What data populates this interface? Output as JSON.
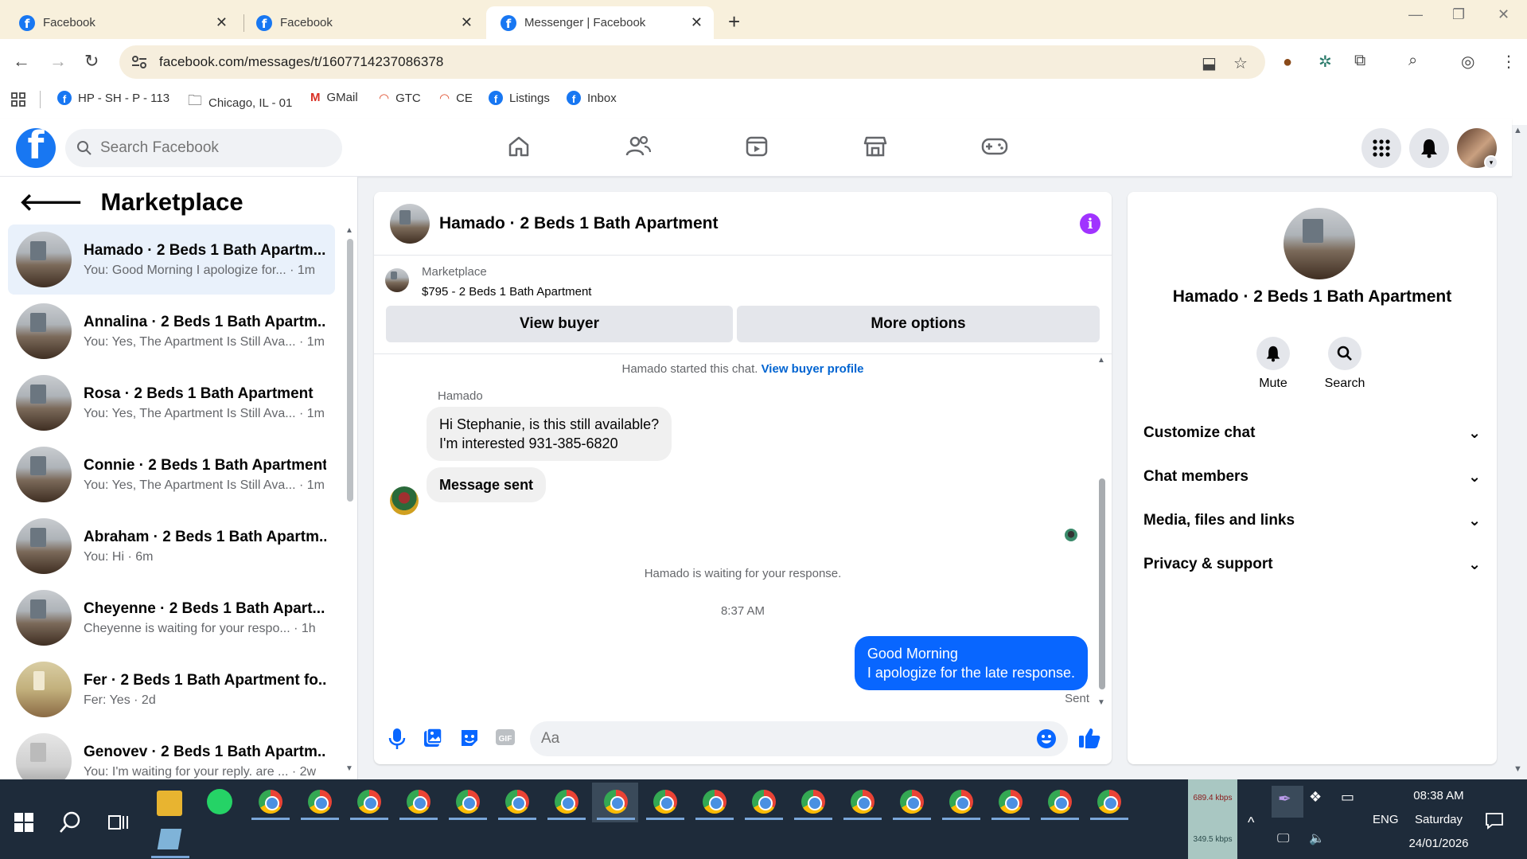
{
  "browser": {
    "tabs": [
      {
        "title": "Facebook",
        "active": false
      },
      {
        "title": "Facebook",
        "active": false
      },
      {
        "title": "Messenger | Facebook",
        "active": true
      }
    ],
    "url": "facebook.com/messages/t/1607714237086378",
    "bookmarks": [
      {
        "label": "HP - SH - P - 113",
        "icon": "facebook-icon"
      },
      {
        "label": "Chicago, IL - 01",
        "icon": "folder-icon"
      },
      {
        "label": "GMail",
        "icon": "gmail-icon"
      },
      {
        "label": "GTC",
        "icon": "rainbow-icon"
      },
      {
        "label": "CE",
        "icon": "rainbow-icon"
      },
      {
        "label": "Listings",
        "icon": "facebook-icon"
      },
      {
        "label": "Inbox",
        "icon": "facebook-icon"
      }
    ]
  },
  "fb": {
    "search_placeholder": "Search Facebook",
    "brand_color": "#1877f2"
  },
  "left": {
    "title": "Marketplace",
    "conversations": [
      {
        "name": "Hamado · 2 Beds 1 Bath Apartm...",
        "preview": "You: Good Morning I apologize for... · 1m",
        "selected": true
      },
      {
        "name": "Annalina · 2 Beds 1 Bath Apartm...",
        "preview": "You: Yes, The Apartment Is Still Ava... · 1m"
      },
      {
        "name": "Rosa · 2 Beds 1 Bath Apartment",
        "preview": "You: Yes, The Apartment Is Still Ava... · 1m"
      },
      {
        "name": "Connie · 2 Beds 1 Bath Apartment",
        "preview": "You: Yes, The Apartment Is Still Ava... · 1m"
      },
      {
        "name": "Abraham · 2 Beds 1 Bath Apartm...",
        "preview": "You: Hi · 6m"
      },
      {
        "name": "Cheyenne · 2 Beds 1 Bath Apart...",
        "preview": "Cheyenne is waiting for your respo... · 1h"
      },
      {
        "name": "Fer · 2 Beds 1 Bath Apartment fo...",
        "preview": "Fer: Yes · 2d"
      },
      {
        "name": "Genovev · 2 Beds 1 Bath Apartm...",
        "preview": "You: I'm waiting for your reply. are ... · 2w"
      }
    ]
  },
  "chat": {
    "title": "Hamado · 2 Beds 1 Bath Apartment",
    "marketplace_label": "Marketplace",
    "listing": "$795 - 2 Beds 1 Bath Apartment",
    "view_buyer": "View buyer",
    "more_options": "More options",
    "started_text": "Hamado started this chat.",
    "view_profile": "View buyer profile",
    "sender": "Hamado",
    "msg1_line1": "Hi Stephanie, is this still available?",
    "msg1_line2": "I'm interested 931-385-6820",
    "msg2": "Message sent",
    "waiting": "Hamado is waiting for your response.",
    "time": "8:37 AM",
    "out_line1": "Good Morning",
    "out_line2": "I apologize for the late response.",
    "status": "Sent",
    "composer_placeholder": "Aa",
    "accent": "#0866ff"
  },
  "right": {
    "name": "Hamado · 2 Beds 1 Bath Apartment",
    "mute": "Mute",
    "search": "Search",
    "sections": [
      "Customize chat",
      "Chat members",
      "Media, files and links",
      "Privacy & support"
    ]
  },
  "taskbar": {
    "net_up": "689.4 kbps",
    "net_down": "349.5 kbps",
    "lang": "ENG",
    "time": "08:38 AM",
    "day": "Saturday",
    "date": "24/01/2026"
  }
}
